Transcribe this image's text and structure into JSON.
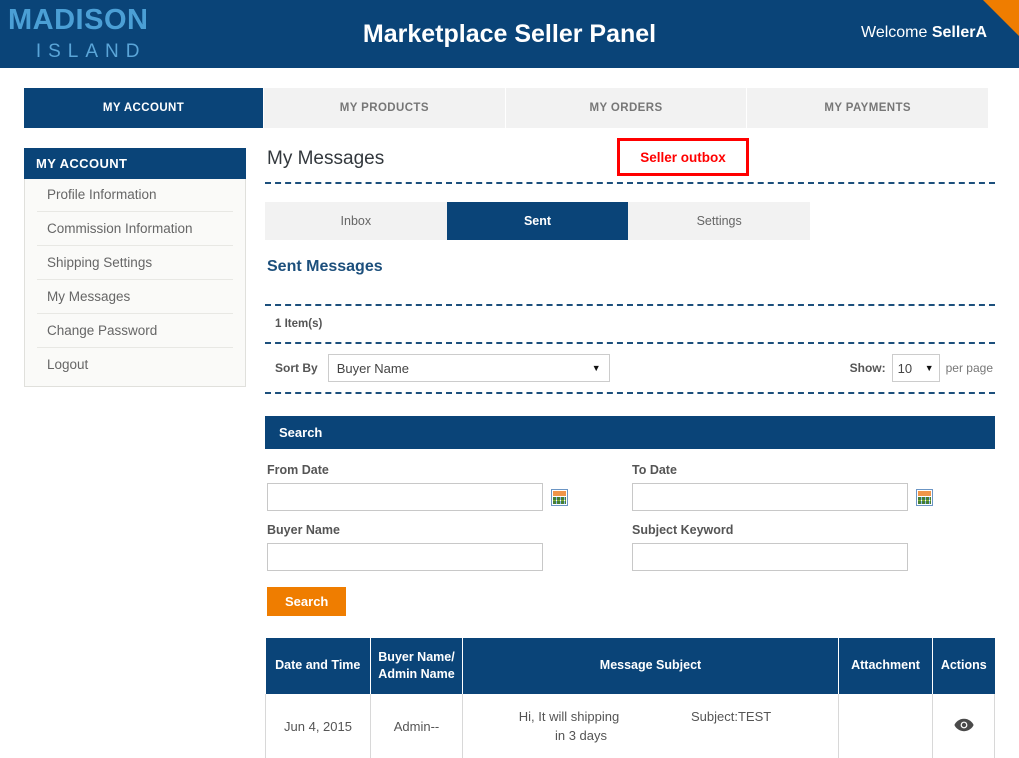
{
  "header": {
    "logo_primary": "MADISON",
    "logo_secondary": "ISLAND",
    "title": "Marketplace Seller Panel",
    "welcome_prefix": "Welcome ",
    "welcome_user": "SellerA",
    "brand_blue": "#0a4478",
    "accent_orange": "#ef7d00",
    "logo_blue": "#4b9fd5"
  },
  "main_nav": {
    "tabs": [
      {
        "label": "MY ACCOUNT",
        "active": true
      },
      {
        "label": "MY PRODUCTS",
        "active": false
      },
      {
        "label": "MY ORDERS",
        "active": false
      },
      {
        "label": "MY PAYMENTS",
        "active": false
      }
    ]
  },
  "sidebar": {
    "heading": "MY ACCOUNT",
    "items": [
      {
        "label": "Profile Information"
      },
      {
        "label": "Commission Information"
      },
      {
        "label": "Shipping Settings"
      },
      {
        "label": "My Messages"
      },
      {
        "label": "Change Password"
      },
      {
        "label": "Logout"
      }
    ]
  },
  "annotation": {
    "text": "Seller outbox",
    "color": "#ff0000"
  },
  "main": {
    "page_title": "My Messages",
    "sub_tabs": [
      {
        "label": "Inbox",
        "active": false
      },
      {
        "label": "Sent",
        "active": true
      },
      {
        "label": "Settings",
        "active": false
      }
    ],
    "section_title": "Sent Messages",
    "item_count": "1 Item(s)",
    "sort_label": "Sort By",
    "sort_value": "Buyer Name",
    "show_label": "Show:",
    "show_value": "10",
    "per_page_label": "per page",
    "caret_glyph": "▼"
  },
  "search": {
    "panel_title": "Search",
    "from_date_label": "From Date",
    "from_date_value": "",
    "from_date_placeholder": "",
    "to_date_label": "To Date",
    "to_date_value": "",
    "to_date_placeholder": "",
    "buyer_name_label": "Buyer Name",
    "buyer_name_value": "",
    "buyer_name_placeholder": "",
    "subject_keyword_label": "Subject Keyword",
    "subject_keyword_value": "",
    "subject_keyword_placeholder": "",
    "button_label": "Search"
  },
  "results": {
    "columns": [
      {
        "label": "Date and Time"
      },
      {
        "label": "Buyer Name/",
        "label2": "Admin Name"
      },
      {
        "label": "Message Subject"
      },
      {
        "label": "Attachment"
      },
      {
        "label": "Actions"
      }
    ],
    "rows": [
      {
        "date": "Jun 4, 2015",
        "buyer": "Admin--",
        "message_line1": "Hi, It will shipping",
        "message_line2": "in 3 days",
        "subject": "Subject:TEST",
        "attachment": "",
        "action_icon": "eye-icon"
      }
    ]
  }
}
